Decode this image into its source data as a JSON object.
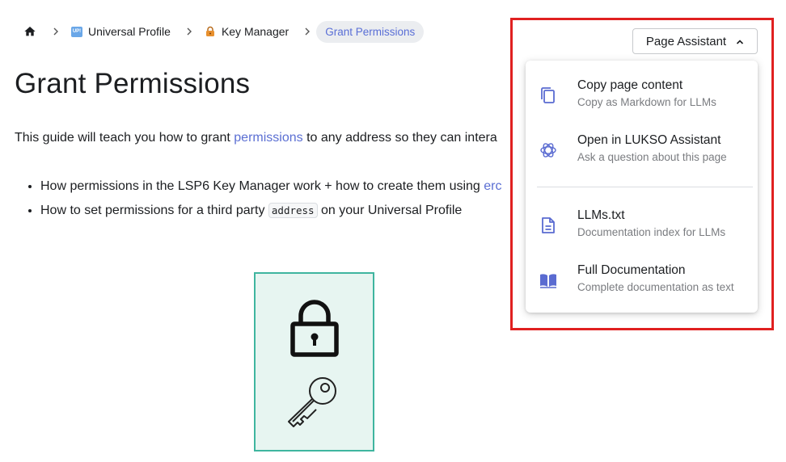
{
  "breadcrumb": {
    "items": [
      {
        "label": "Universal Profile",
        "icon": "up-icon"
      },
      {
        "label": "Key Manager",
        "icon": "lock-icon"
      }
    ],
    "active": "Grant Permissions",
    "up_badge": "UP!"
  },
  "page": {
    "title": "Grant Permissions",
    "intro_before": "This guide will teach you how to grant ",
    "intro_link": "permissions",
    "intro_after": " to any address so they can intera",
    "bullets": [
      {
        "text": "How permissions in the LSP6 Key Manager work + how to create them using ",
        "link": "erc"
      },
      {
        "before": "How to set permissions for a third party ",
        "code": "address",
        "after": " on your Universal Profile"
      }
    ]
  },
  "page_assistant": {
    "button_label": "Page Assistant",
    "items": [
      {
        "label": "Copy page content",
        "desc": "Copy as Markdown for LLMs",
        "icon": "copy-icon"
      },
      {
        "label": "Open in LUKSO Assistant",
        "desc": "Ask a question about this page",
        "icon": "openai-icon"
      },
      {
        "label": "LLMs.txt",
        "desc": "Documentation index for LLMs",
        "icon": "document-icon"
      },
      {
        "label": "Full Documentation",
        "desc": "Complete documentation as text",
        "icon": "book-icon"
      }
    ]
  },
  "colors": {
    "accent": "#5b6fd3",
    "highlight": "#e02020",
    "illustration_bg": "#e7f5f1",
    "illustration_border": "#3fb59f"
  }
}
